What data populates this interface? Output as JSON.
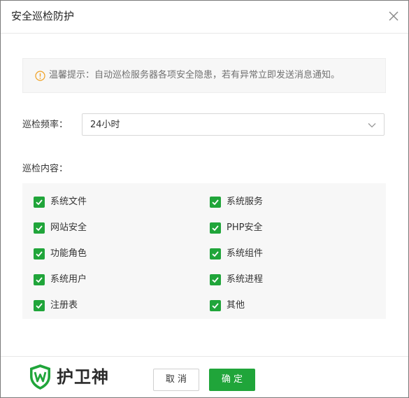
{
  "dialog": {
    "title": "安全巡检防护",
    "close_icon": "close-icon"
  },
  "notice": {
    "icon": "warning-circle-icon",
    "text": "温馨提示：自动巡检服务器各项安全隐患，若有异常立即发送消息通知。"
  },
  "frequency": {
    "label": "巡检频率：",
    "selected": "24小时"
  },
  "content": {
    "label": "巡检内容：",
    "items": [
      {
        "label": "系统文件",
        "checked": true
      },
      {
        "label": "系统服务",
        "checked": true
      },
      {
        "label": "网站安全",
        "checked": true
      },
      {
        "label": "PHP安全",
        "checked": true
      },
      {
        "label": "功能角色",
        "checked": true
      },
      {
        "label": "系统组件",
        "checked": true
      },
      {
        "label": "系统用户",
        "checked": true
      },
      {
        "label": "系统进程",
        "checked": true
      },
      {
        "label": "注册表",
        "checked": true
      },
      {
        "label": "其他",
        "checked": true
      }
    ]
  },
  "footer": {
    "brand": "护卫神",
    "cancel_label": "取 消",
    "ok_label": "确 定"
  },
  "colors": {
    "accent": "#20a53a",
    "warning": "#f0a020"
  }
}
